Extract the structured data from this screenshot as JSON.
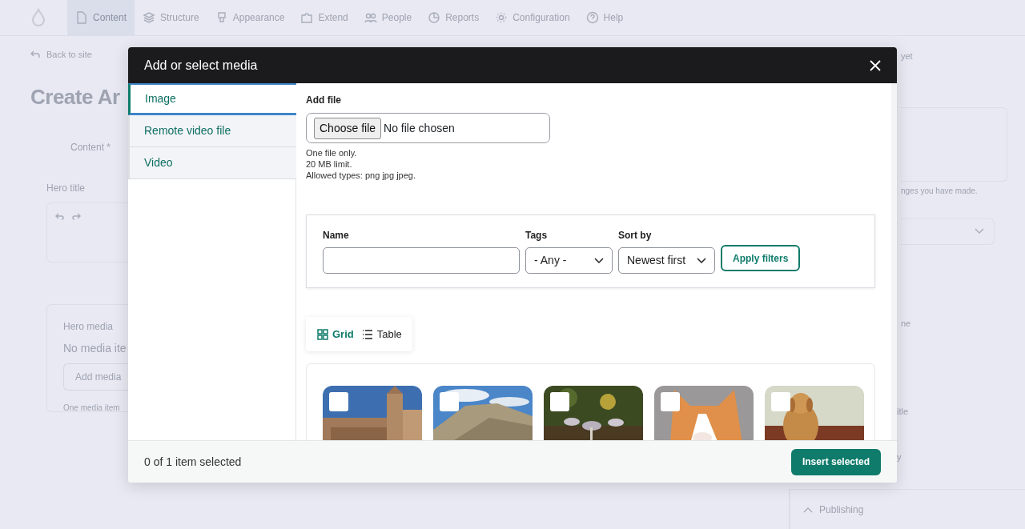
{
  "toolbar": {
    "items": [
      {
        "label": "Content",
        "selected": true
      },
      {
        "label": "Structure",
        "selected": false
      },
      {
        "label": "Appearance",
        "selected": false
      },
      {
        "label": "Extend",
        "selected": false
      },
      {
        "label": "People",
        "selected": false
      },
      {
        "label": "Reports",
        "selected": false
      },
      {
        "label": "Configuration",
        "selected": false
      },
      {
        "label": "Help",
        "selected": false
      }
    ]
  },
  "background_page": {
    "back_link": "Back to site",
    "page_title": "Create Ar",
    "tab": "Content *",
    "hero_title_label": "Hero title",
    "hero_media": {
      "label": "Hero media",
      "empty_text": "No media ite",
      "button": "Add media",
      "description": "One media item"
    },
    "sidebar_fragments": [
      "yet",
      "nges you have made.",
      "ne",
      "itle",
      "y"
    ],
    "publishing": "Publishing"
  },
  "modal": {
    "title": "Add or select media",
    "tabs": [
      {
        "label": "Image",
        "selected": true
      },
      {
        "label": "Remote video file",
        "selected": false
      },
      {
        "label": "Video",
        "selected": false
      }
    ],
    "add_file": {
      "label": "Add file",
      "button": "Choose file",
      "status": "No file chosen",
      "help": [
        "One file only.",
        "20 MB limit.",
        "Allowed types: png jpg jpeg."
      ]
    },
    "filters": {
      "name_label": "Name",
      "tags_label": "Tags",
      "tags_value": "- Any -",
      "sort_label": "Sort by",
      "sort_value": "Newest first",
      "apply": "Apply filters"
    },
    "views": [
      {
        "label": "Grid",
        "selected": true
      },
      {
        "label": "Table",
        "selected": false
      }
    ],
    "footer": {
      "status": "0 of 1 item selected",
      "button": "Insert selected"
    }
  }
}
